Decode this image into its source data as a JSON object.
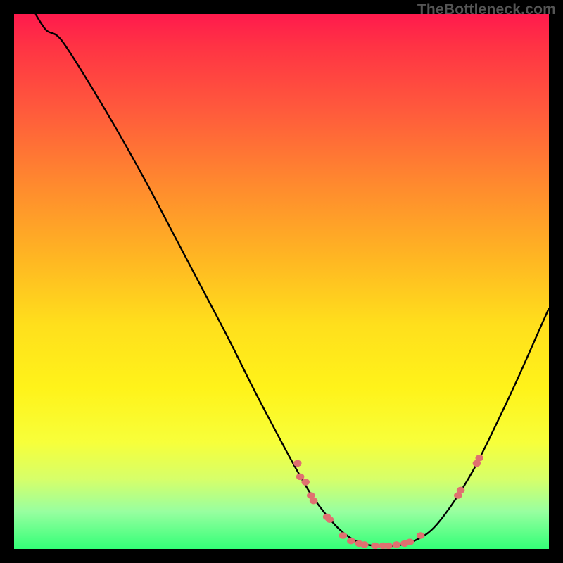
{
  "watermark": "TheBottleneck.com",
  "chart_data": {
    "type": "line",
    "title": "",
    "xlabel": "",
    "ylabel": "",
    "xlim": [
      0,
      100
    ],
    "ylim": [
      0,
      100
    ],
    "curve": {
      "name": "bottleneck-curve",
      "points": [
        {
          "x": 4.0,
          "y": 100.0
        },
        {
          "x": 6.0,
          "y": 97.0
        },
        {
          "x": 8.0,
          "y": 96.0
        },
        {
          "x": 10.0,
          "y": 93.5
        },
        {
          "x": 15.0,
          "y": 85.5
        },
        {
          "x": 20.0,
          "y": 77.0
        },
        {
          "x": 25.0,
          "y": 68.0
        },
        {
          "x": 30.0,
          "y": 58.5
        },
        {
          "x": 35.0,
          "y": 49.0
        },
        {
          "x": 40.0,
          "y": 39.5
        },
        {
          "x": 45.0,
          "y": 29.5
        },
        {
          "x": 50.0,
          "y": 20.0
        },
        {
          "x": 53.0,
          "y": 14.5
        },
        {
          "x": 56.0,
          "y": 9.5
        },
        {
          "x": 60.0,
          "y": 4.5
        },
        {
          "x": 63.0,
          "y": 2.0
        },
        {
          "x": 66.0,
          "y": 0.8
        },
        {
          "x": 70.0,
          "y": 0.5
        },
        {
          "x": 74.0,
          "y": 1.2
        },
        {
          "x": 78.0,
          "y": 3.5
        },
        {
          "x": 82.0,
          "y": 8.5
        },
        {
          "x": 86.0,
          "y": 15.0
        },
        {
          "x": 90.0,
          "y": 23.0
        },
        {
          "x": 94.0,
          "y": 31.5
        },
        {
          "x": 98.0,
          "y": 40.5
        },
        {
          "x": 100.0,
          "y": 45.0
        }
      ]
    },
    "scatter": {
      "name": "data-points",
      "points": [
        {
          "x": 53.0,
          "y": 16.0,
          "r": 5
        },
        {
          "x": 53.5,
          "y": 13.5,
          "r": 5
        },
        {
          "x": 54.5,
          "y": 12.5,
          "r": 5
        },
        {
          "x": 55.5,
          "y": 10.0,
          "r": 5
        },
        {
          "x": 56.0,
          "y": 9.0,
          "r": 5
        },
        {
          "x": 58.5,
          "y": 6.0,
          "r": 5
        },
        {
          "x": 59.0,
          "y": 5.5,
          "r": 5
        },
        {
          "x": 61.5,
          "y": 2.5,
          "r": 5
        },
        {
          "x": 63.0,
          "y": 1.5,
          "r": 5
        },
        {
          "x": 64.5,
          "y": 1.0,
          "r": 5
        },
        {
          "x": 65.5,
          "y": 0.8,
          "r": 5
        },
        {
          "x": 67.5,
          "y": 0.6,
          "r": 5
        },
        {
          "x": 69.0,
          "y": 0.6,
          "r": 5
        },
        {
          "x": 70.0,
          "y": 0.6,
          "r": 5
        },
        {
          "x": 71.5,
          "y": 0.8,
          "r": 5
        },
        {
          "x": 73.0,
          "y": 1.0,
          "r": 5
        },
        {
          "x": 74.0,
          "y": 1.3,
          "r": 5
        },
        {
          "x": 76.0,
          "y": 2.5,
          "r": 5
        },
        {
          "x": 83.0,
          "y": 10.0,
          "r": 5
        },
        {
          "x": 83.5,
          "y": 11.0,
          "r": 5
        },
        {
          "x": 86.5,
          "y": 16.0,
          "r": 5
        },
        {
          "x": 87.0,
          "y": 17.0,
          "r": 5
        }
      ]
    }
  }
}
